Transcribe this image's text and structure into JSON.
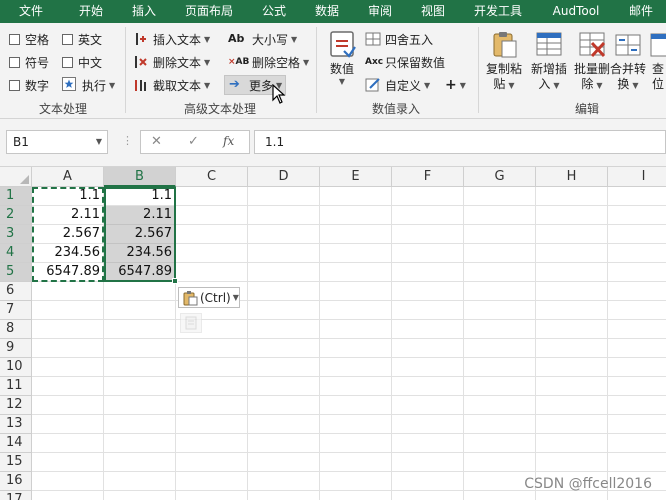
{
  "tabs": [
    "文件",
    "开始",
    "插入",
    "页面布局",
    "公式",
    "数据",
    "审阅",
    "视图",
    "开发工具",
    "AudTool",
    "邮件"
  ],
  "ribbon": {
    "text_group": {
      "label": "文本处理",
      "checkboxes": [
        "空格",
        "英文",
        "符号",
        "中文",
        "数字"
      ],
      "execute": "执行"
    },
    "advanced_group": {
      "label": "高级文本处理",
      "insert_text": "插入文本",
      "delete_text": "删除文本",
      "extract_text": "截取文本",
      "case": "大小写",
      "delete_space": "删除空格",
      "more": "更多"
    },
    "numeric_group": {
      "label": "数值录入",
      "value": "数值",
      "round": "四舍五入",
      "keep_value": "只保留数值",
      "custom": "自定义",
      "plus": "+"
    },
    "edit_group": {
      "label": "编辑",
      "copy_paste": [
        "复制粘",
        "贴"
      ],
      "insert_new": [
        "新增插",
        "入"
      ],
      "batch_delete": [
        "批量删",
        "除"
      ],
      "merge_convert": [
        "合并转",
        "换"
      ],
      "lookup": [
        "查",
        "位"
      ]
    }
  },
  "formula_bar": {
    "name_box": "B1",
    "cancel": "✕",
    "confirm": "✓",
    "fx": "fx",
    "formula": "1.1"
  },
  "grid": {
    "columns": [
      "A",
      "B",
      "C",
      "D",
      "E",
      "F",
      "G",
      "H",
      "I"
    ],
    "selected_column": "B",
    "rows": [
      "1",
      "2",
      "3",
      "4",
      "5",
      "6",
      "7",
      "8",
      "9",
      "10",
      "11",
      "12",
      "13",
      "14",
      "15",
      "16",
      "17"
    ],
    "column_a": [
      "1.1",
      "2.11",
      "2.567",
      "234.56",
      "6547.89"
    ],
    "column_b": [
      "1.1",
      "2.11",
      "2.567",
      "234.56",
      "6547.89"
    ]
  },
  "paste_options": "(Ctrl)",
  "watermark": "CSDN @ffcell2016",
  "colors": {
    "accent": "#217346",
    "selection": "#d4d4d4"
  }
}
